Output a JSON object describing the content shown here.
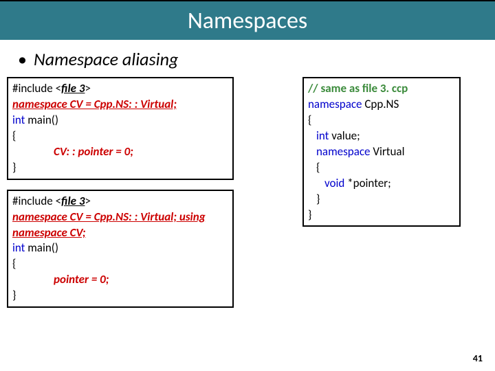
{
  "title": "Namespaces",
  "subtitle": "Namespace aliasing",
  "bullet": "•",
  "page_number": "41",
  "box1": {
    "l1a": "#include",
    "l1b": "<",
    "l1c": "file 3",
    "l1d": ">",
    "l2": "namespace CV = Cpp.NS: : Virtual;",
    "l3a": "int",
    "l3b": "main()",
    "l4": "{",
    "l5": "CV: : pointer = 0;",
    "l6": "}"
  },
  "box2": {
    "l1a": "#include",
    "l1b": "<",
    "l1c": "file 3",
    "l1d": ">",
    "l2a": "namespace CV = Cpp.NS: : Virtual;",
    "l2b": "using",
    "l3": "namespace CV;",
    "l4a": "int",
    "l4b": "main()",
    "l5": "{",
    "l6": "pointer = 0;",
    "l7": "}"
  },
  "box3": {
    "l1": "// same as file 3. ccp",
    "l2a": "namespace",
    "l2b": "Cpp.NS",
    "l3": "{",
    "l4a": "int",
    "l4b": "value;",
    "l5a": "namespace",
    "l5b": "Virtual",
    "l6": "{",
    "l7a": "void",
    "l7b": "*pointer;",
    "l8": "}",
    "l9": "}"
  }
}
